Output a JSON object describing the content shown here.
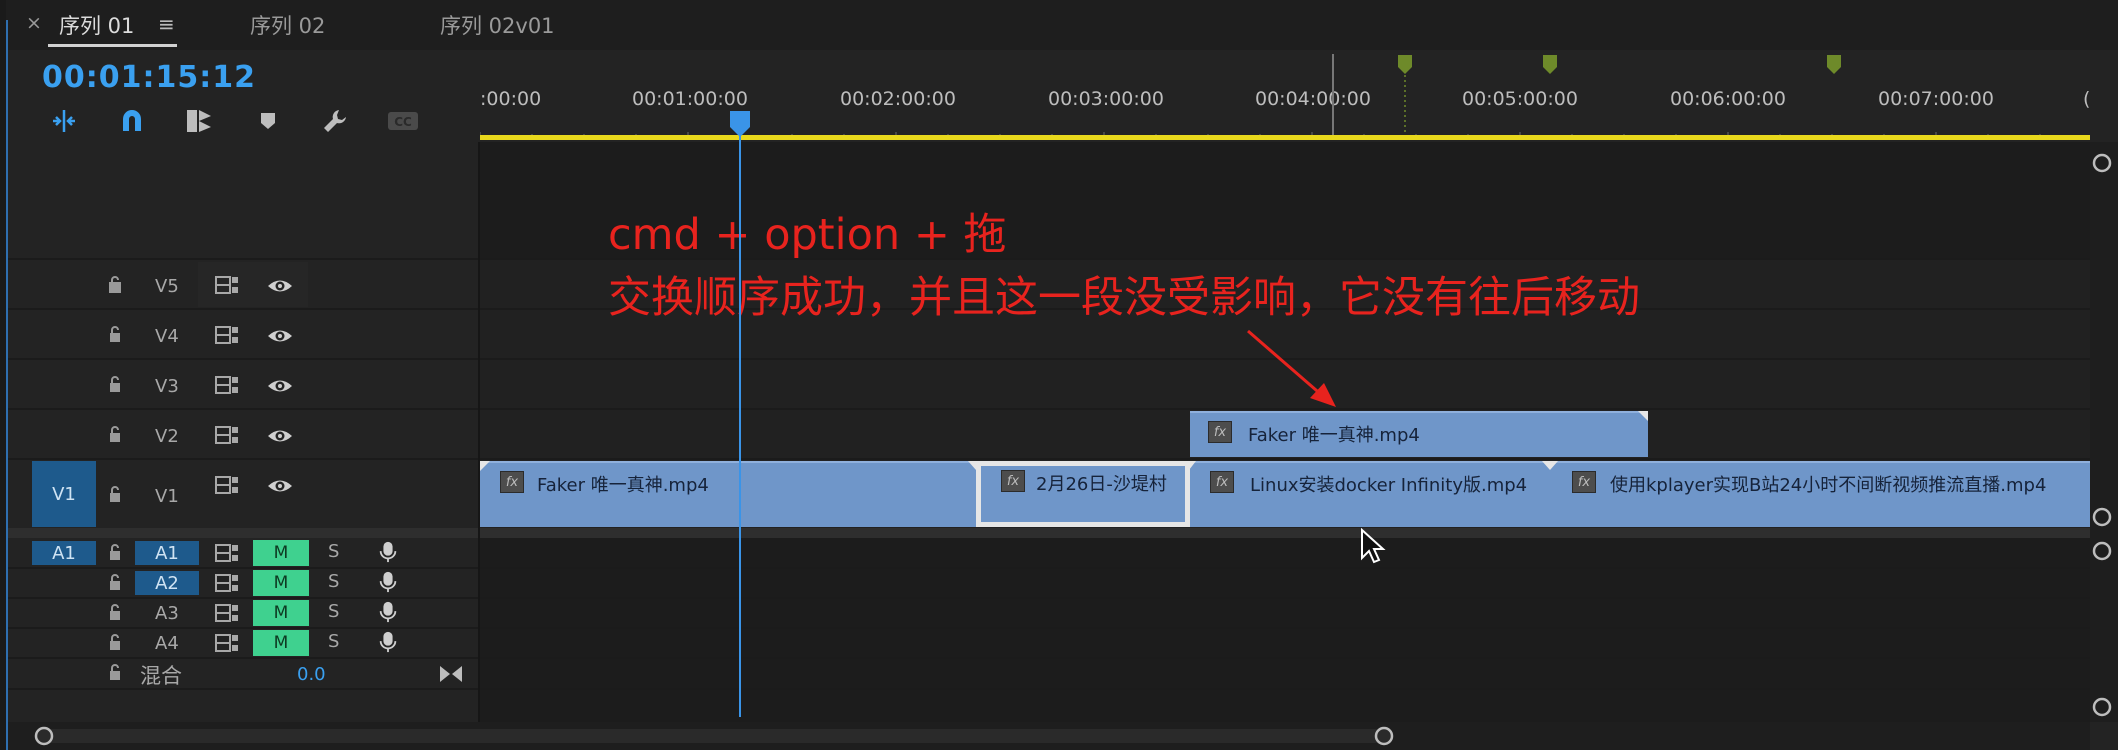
{
  "tabs": {
    "close_glyph": "×",
    "menu_glyph": "≡",
    "items": [
      {
        "label": "序列 01",
        "active": true
      },
      {
        "label": "序列 02",
        "active": false
      },
      {
        "label": "序列 02v01",
        "active": false
      }
    ]
  },
  "timecode": "00:01:15:12",
  "toolbar": {
    "tools": [
      "ripple-insert-icon",
      "snap-magnet-icon",
      "linked-selection-icon",
      "marker-icon",
      "wrench-icon",
      "captions-icon"
    ],
    "captions_label": "CC"
  },
  "ruler": {
    "labels": [
      ":00:00",
      "00:01:00:00",
      "00:02:00:00",
      "00:03:00:00",
      "00:04:00:00",
      "00:05:00:00",
      "00:06:00:00",
      "00:07:00:00",
      "("
    ],
    "marker_color": "#6e8a2a"
  },
  "tracks": {
    "video": [
      {
        "name": "V5"
      },
      {
        "name": "V4"
      },
      {
        "name": "V3"
      },
      {
        "name": "V2"
      },
      {
        "name": "V1",
        "source": "V1"
      }
    ],
    "audio": [
      {
        "name": "A1",
        "source": "A1",
        "mute": "M",
        "solo": "S"
      },
      {
        "name": "A2",
        "mute": "M",
        "solo": "S"
      },
      {
        "name": "A3",
        "mute": "M",
        "solo": "S"
      },
      {
        "name": "A4",
        "mute": "M",
        "solo": "S"
      }
    ],
    "mix": {
      "label": "混合",
      "value": "0.0"
    }
  },
  "clips": {
    "v2": [
      {
        "name": "Faker 唯一真神.mp4"
      }
    ],
    "v1": [
      {
        "name": "Faker 唯一真神.mp4"
      },
      {
        "name": "2月26日-沙堤村"
      },
      {
        "name": "Linux安装docker Infinity版.mp4"
      },
      {
        "name": "使用kplayer实现B站24小时不间断视频推流直播.mp4"
      }
    ],
    "fx_label": "fx"
  },
  "annotation": {
    "line1": "cmd + option + 拖",
    "line2": "交换顺序成功，并且这一段没受影响，它没有往后移动",
    "color": "#e8231e"
  },
  "colors": {
    "accent_timecode": "#3aa0f0",
    "clip_blue": "#6f96c9",
    "mute_green": "#3fd18f",
    "target_blue": "#1e5a8c",
    "work_area": "#e8d81c"
  }
}
